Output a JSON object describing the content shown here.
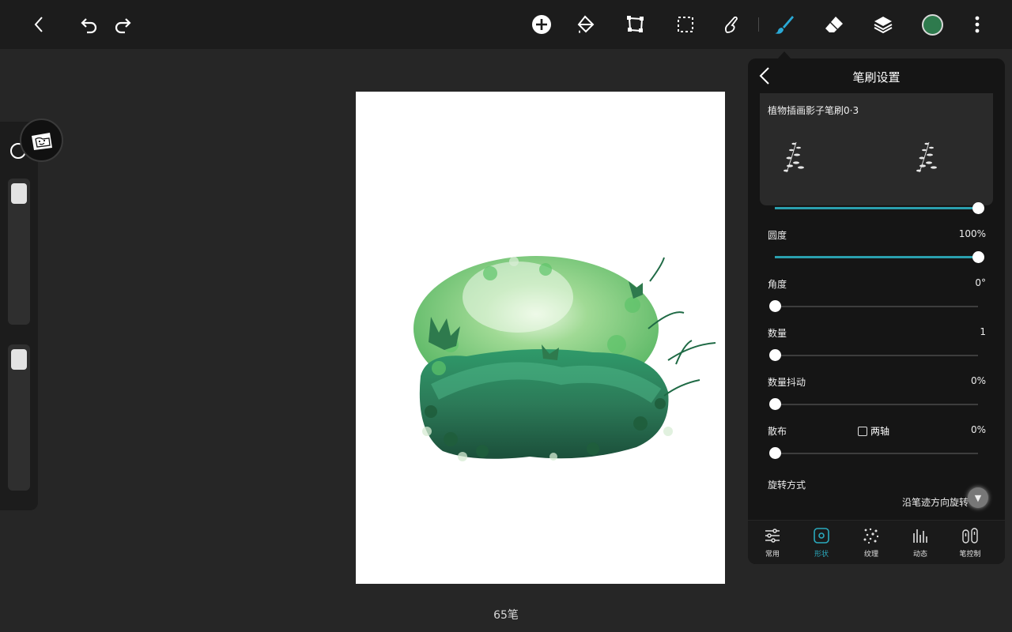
{
  "colors": {
    "accent": "#2a9fae",
    "current_color": "#2e7a4d",
    "panel_bg": "#151515",
    "topbar_bg": "#1c1c1c"
  },
  "toolbar": {
    "icons": [
      "back-icon",
      "undo-icon",
      "redo-icon",
      "add-icon",
      "fill-bucket-icon",
      "transform-icon",
      "selection-icon",
      "smudge-icon",
      "brush-icon",
      "eraser-icon",
      "layers-icon",
      "color-icon",
      "more-icon"
    ]
  },
  "canvas": {
    "stroke_count": "65笔"
  },
  "brush_panel": {
    "title": "笔刷设置",
    "brush_name": "植物插画影子笔刷0·3",
    "top_slider_level": 1.0,
    "roundness": {
      "label": "圆度",
      "value": "100%",
      "level": 1.0
    },
    "angle": {
      "label": "角度",
      "value": "0°",
      "level": 0.0
    },
    "count": {
      "label": "数量",
      "value": "1",
      "level": 0.0
    },
    "count_jitter": {
      "label": "数量抖动",
      "value": "0%",
      "level": 0.0
    },
    "scatter": {
      "label": "散布",
      "value": "0%",
      "two_axis_label": "两轴",
      "two_axis_checked": false,
      "level": 0.0
    },
    "rotation": {
      "label": "旋转方式",
      "value": "沿笔迹方向旋转"
    },
    "tabs": [
      {
        "label": "常用",
        "icon": "sliders-icon",
        "active": false
      },
      {
        "label": "形状",
        "icon": "shape-icon",
        "active": true
      },
      {
        "label": "纹理",
        "icon": "texture-icon",
        "active": false
      },
      {
        "label": "动态",
        "icon": "dynamics-icon",
        "active": false
      },
      {
        "label": "笔控制",
        "icon": "pen-control-icon",
        "active": false
      }
    ]
  }
}
